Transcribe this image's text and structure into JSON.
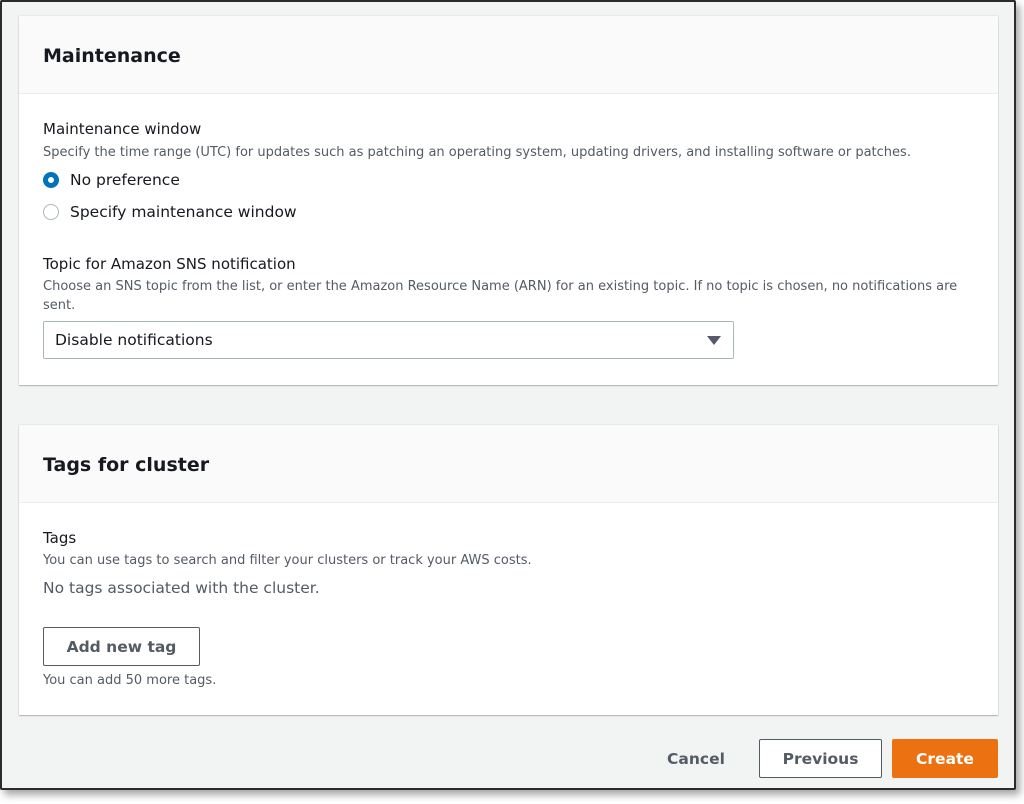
{
  "maintenance": {
    "title": "Maintenance",
    "window": {
      "label": "Maintenance window",
      "description": "Specify the time range (UTC) for updates such as patching an operating system, updating drivers, and installing software or patches.",
      "options": [
        {
          "label": "No preference",
          "checked": true
        },
        {
          "label": "Specify maintenance window",
          "checked": false
        }
      ]
    },
    "sns": {
      "label": "Topic for Amazon SNS notification",
      "description_line1": "Choose an SNS topic from the list, or enter the Amazon Resource Name (ARN) for an existing topic. If no topic is chosen, no notifications are",
      "description_line2": "sent.",
      "selected": "Disable notifications",
      "caret_icon": "caret-down-icon"
    }
  },
  "tags": {
    "title": "Tags for cluster",
    "label": "Tags",
    "description": "You can use tags to search and filter your clusters or track your AWS costs.",
    "empty_text": "No tags associated with the cluster.",
    "add_button": "Add new tag",
    "limit_text": "You can add 50 more tags."
  },
  "footer": {
    "cancel": "Cancel",
    "previous": "Previous",
    "create": "Create"
  },
  "colors": {
    "accent": "#0073bb",
    "primary_button": "#ec7211",
    "background": "#f2f3f3"
  }
}
